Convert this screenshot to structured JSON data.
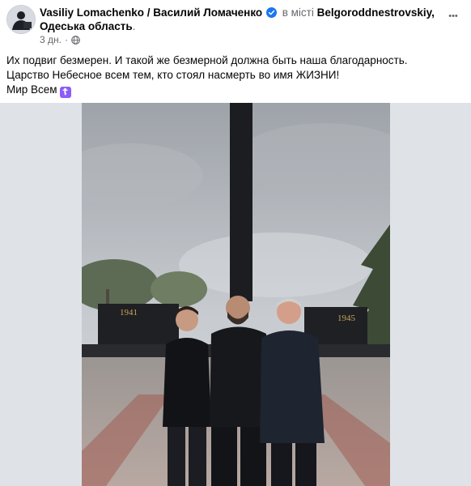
{
  "post": {
    "author": "Vasiliy Lomachenko / Василий Ломаченко",
    "location_prefix": "в місті",
    "location_city": "Belgoroddnestrovskiy,",
    "location_region": "Одеська область",
    "location_suffix": ".",
    "time": "3 дн.",
    "dot": "·",
    "more_label": "•••",
    "text_lines": [
      "Их подвиг безмерен. И такой же безмерной должна быть наша благодарность.",
      "Царство Небесное всем тем, кто стоял насмерть во имя ЖИЗНИ!",
      "Мир Всем"
    ],
    "emoji_glyph": "☦"
  },
  "photo": {
    "monument_years": [
      "1941",
      "1945"
    ]
  },
  "colors": {
    "verified": "#1877f2",
    "muted": "#65676b",
    "emoji_bg": "#8b5cf6"
  }
}
